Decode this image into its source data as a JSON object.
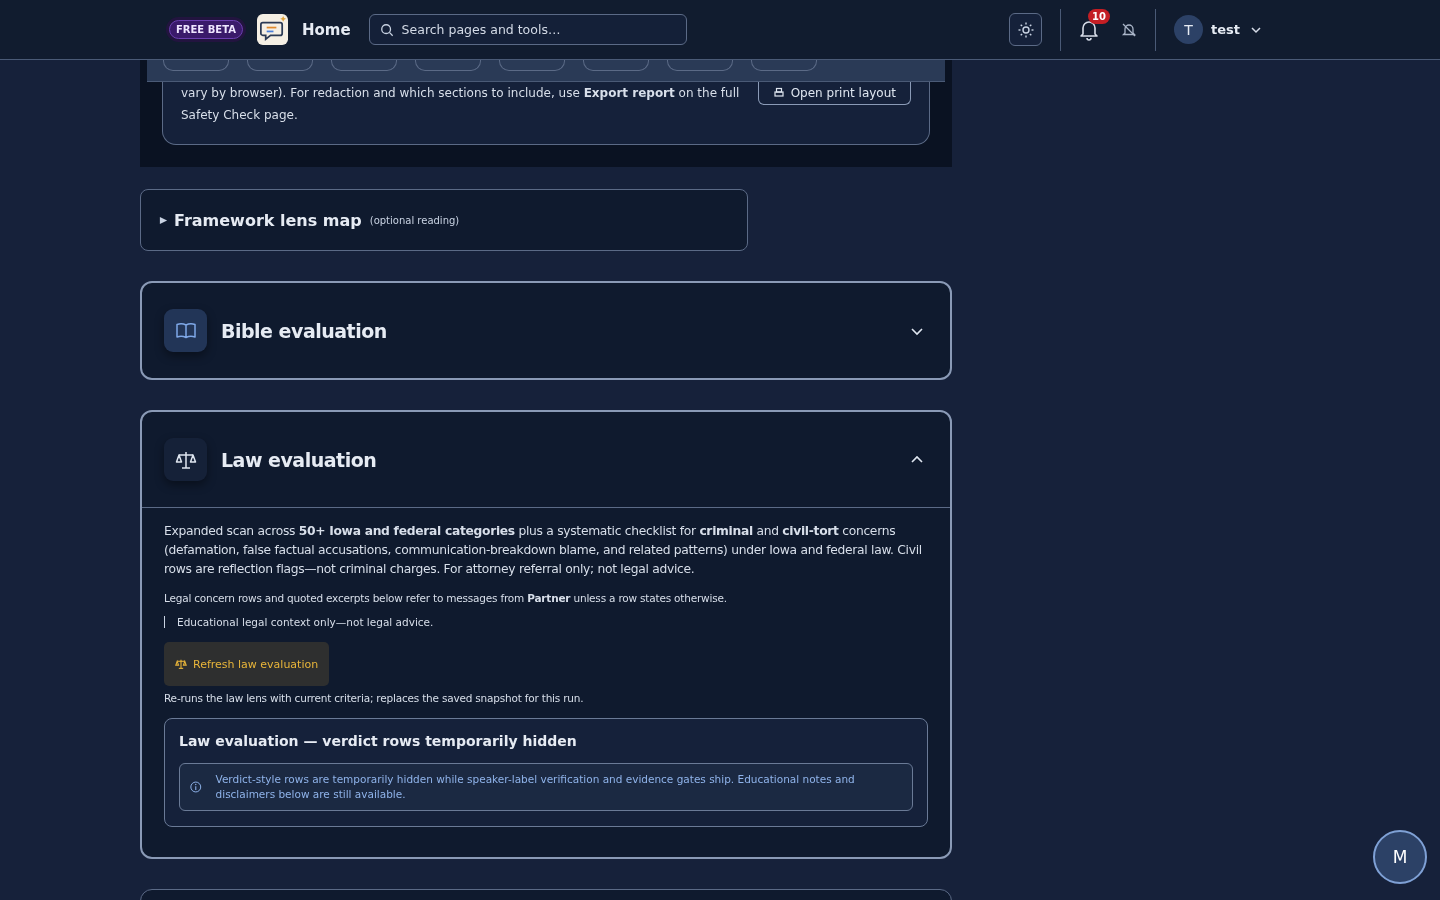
{
  "header": {
    "badge": "FREE BETA",
    "home": "Home",
    "search": {
      "placeholder": "Search pages and tools…"
    },
    "notifications": "10",
    "user": {
      "initial": "T",
      "name": "test"
    }
  },
  "print_card": {
    "text": "vary by browser). For redaction and which sections to include, use **Export report** on the full Safety Check page.",
    "button": "Open print layout"
  },
  "framework": {
    "title": "Framework lens map",
    "note": "(optional reading)",
    "expanded": false
  },
  "sections": [
    {
      "title": "Bible evaluation",
      "expanded": false
    },
    {
      "title": "Law evaluation",
      "expanded": true,
      "intro": "Expanded scan across **50+ Iowa and federal categories** plus a systematic checklist for **criminal** and **civil-tort** concerns (defamation, false factual accusations, communication-breakdown blame, and related patterns) under Iowa and federal law. Civil rows are reflection flags—not criminal charges. For attorney referral only; not legal advice.",
      "scope": "Legal concern rows and quoted excerpts below refer to messages from **Partner** unless a row states otherwise.",
      "quote": "Educational legal context only—not legal advice.",
      "button": "Refresh law evaluation",
      "button_note": "Re-runs the law lens with current criteria; replaces the saved snapshot for this run.",
      "notice": {
        "title": "Law evaluation — verdict rows temporarily hidden",
        "text": "Verdict-style rows are temporarily hidden while speaker-label verification and evidence gates ship. Educational notes and disclaimers below are still available."
      }
    }
  ],
  "assistant": {
    "initial": "M"
  }
}
